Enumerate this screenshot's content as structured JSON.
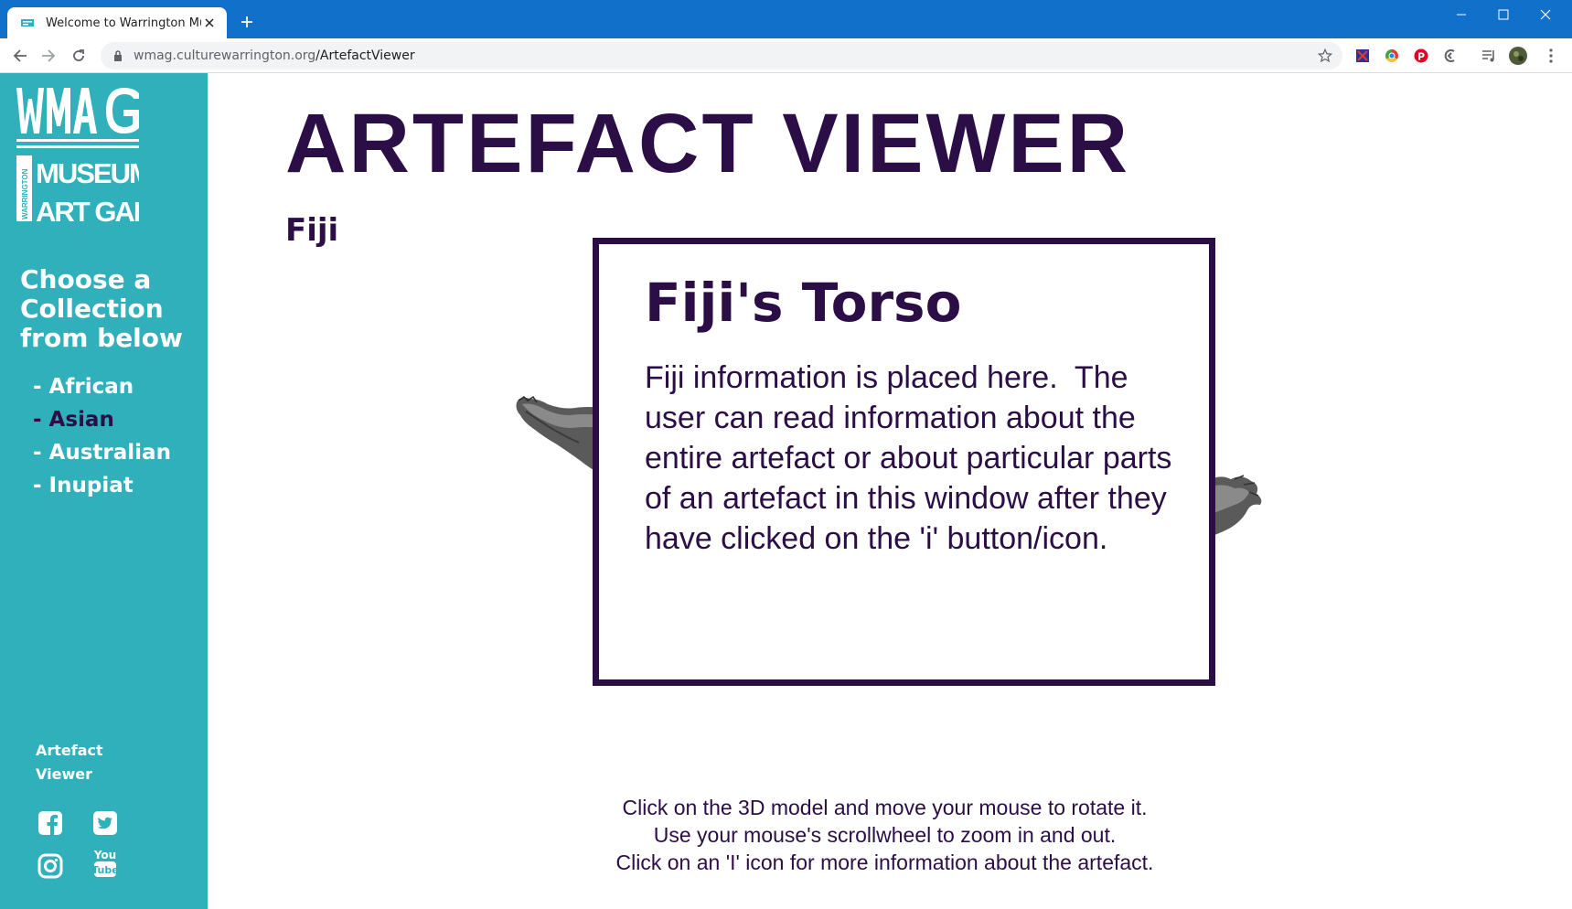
{
  "browser": {
    "tab_title": "Welcome to Warrington Museum",
    "url_host": "wmag.culturewarrington.org",
    "url_path": "/ArtefactViewer"
  },
  "sidebar": {
    "logo_text": "WMAG WARRINGTON MUSEUM & ART GALLERY",
    "heading": "Choose a Collection from below",
    "collections": [
      {
        "label": "- African",
        "active": false
      },
      {
        "label": "- Asian",
        "active": true
      },
      {
        "label": "- Australian",
        "active": false
      },
      {
        "label": "- Inupiat",
        "active": false
      }
    ],
    "subheading": "Artefact Viewer",
    "social_icons": [
      "facebook-icon",
      "twitter-icon",
      "instagram-icon",
      "youtube-icon"
    ]
  },
  "main": {
    "title": "ARTEFACT VIEWER",
    "collection_name": "Fiji",
    "info": {
      "title": "Fiji's Torso",
      "body": "Fiji information is placed here.  The user can read information about the entire artefact or about particular parts of an artefact in this window after they have clicked on the 'i' button/icon."
    },
    "instructions": [
      "Click on the 3D model and move your mouse to rotate it.",
      "Use your mouse's scrollwheel to zoom in and out.",
      "Click on an 'I' icon for more information about the artefact."
    ]
  },
  "colors": {
    "titlebar": "#1170ca",
    "sidebar": "#2fb0bb",
    "primary_text": "#2b0e45",
    "active_collection": "#2b0e45"
  }
}
